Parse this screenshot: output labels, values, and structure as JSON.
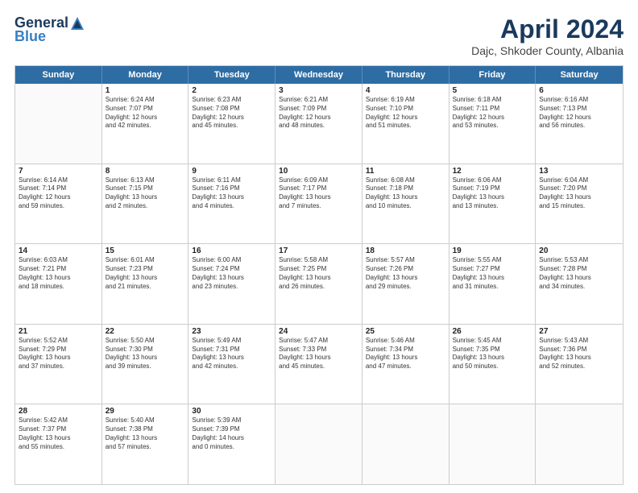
{
  "header": {
    "logo_general": "General",
    "logo_blue": "Blue",
    "month_title": "April 2024",
    "subtitle": "Dajc, Shkoder County, Albania"
  },
  "weekdays": [
    "Sunday",
    "Monday",
    "Tuesday",
    "Wednesday",
    "Thursday",
    "Friday",
    "Saturday"
  ],
  "rows": [
    [
      {
        "day": "",
        "text": ""
      },
      {
        "day": "1",
        "text": "Sunrise: 6:24 AM\nSunset: 7:07 PM\nDaylight: 12 hours\nand 42 minutes."
      },
      {
        "day": "2",
        "text": "Sunrise: 6:23 AM\nSunset: 7:08 PM\nDaylight: 12 hours\nand 45 minutes."
      },
      {
        "day": "3",
        "text": "Sunrise: 6:21 AM\nSunset: 7:09 PM\nDaylight: 12 hours\nand 48 minutes."
      },
      {
        "day": "4",
        "text": "Sunrise: 6:19 AM\nSunset: 7:10 PM\nDaylight: 12 hours\nand 51 minutes."
      },
      {
        "day": "5",
        "text": "Sunrise: 6:18 AM\nSunset: 7:11 PM\nDaylight: 12 hours\nand 53 minutes."
      },
      {
        "day": "6",
        "text": "Sunrise: 6:16 AM\nSunset: 7:13 PM\nDaylight: 12 hours\nand 56 minutes."
      }
    ],
    [
      {
        "day": "7",
        "text": "Sunrise: 6:14 AM\nSunset: 7:14 PM\nDaylight: 12 hours\nand 59 minutes."
      },
      {
        "day": "8",
        "text": "Sunrise: 6:13 AM\nSunset: 7:15 PM\nDaylight: 13 hours\nand 2 minutes."
      },
      {
        "day": "9",
        "text": "Sunrise: 6:11 AM\nSunset: 7:16 PM\nDaylight: 13 hours\nand 4 minutes."
      },
      {
        "day": "10",
        "text": "Sunrise: 6:09 AM\nSunset: 7:17 PM\nDaylight: 13 hours\nand 7 minutes."
      },
      {
        "day": "11",
        "text": "Sunrise: 6:08 AM\nSunset: 7:18 PM\nDaylight: 13 hours\nand 10 minutes."
      },
      {
        "day": "12",
        "text": "Sunrise: 6:06 AM\nSunset: 7:19 PM\nDaylight: 13 hours\nand 13 minutes."
      },
      {
        "day": "13",
        "text": "Sunrise: 6:04 AM\nSunset: 7:20 PM\nDaylight: 13 hours\nand 15 minutes."
      }
    ],
    [
      {
        "day": "14",
        "text": "Sunrise: 6:03 AM\nSunset: 7:21 PM\nDaylight: 13 hours\nand 18 minutes."
      },
      {
        "day": "15",
        "text": "Sunrise: 6:01 AM\nSunset: 7:23 PM\nDaylight: 13 hours\nand 21 minutes."
      },
      {
        "day": "16",
        "text": "Sunrise: 6:00 AM\nSunset: 7:24 PM\nDaylight: 13 hours\nand 23 minutes."
      },
      {
        "day": "17",
        "text": "Sunrise: 5:58 AM\nSunset: 7:25 PM\nDaylight: 13 hours\nand 26 minutes."
      },
      {
        "day": "18",
        "text": "Sunrise: 5:57 AM\nSunset: 7:26 PM\nDaylight: 13 hours\nand 29 minutes."
      },
      {
        "day": "19",
        "text": "Sunrise: 5:55 AM\nSunset: 7:27 PM\nDaylight: 13 hours\nand 31 minutes."
      },
      {
        "day": "20",
        "text": "Sunrise: 5:53 AM\nSunset: 7:28 PM\nDaylight: 13 hours\nand 34 minutes."
      }
    ],
    [
      {
        "day": "21",
        "text": "Sunrise: 5:52 AM\nSunset: 7:29 PM\nDaylight: 13 hours\nand 37 minutes."
      },
      {
        "day": "22",
        "text": "Sunrise: 5:50 AM\nSunset: 7:30 PM\nDaylight: 13 hours\nand 39 minutes."
      },
      {
        "day": "23",
        "text": "Sunrise: 5:49 AM\nSunset: 7:31 PM\nDaylight: 13 hours\nand 42 minutes."
      },
      {
        "day": "24",
        "text": "Sunrise: 5:47 AM\nSunset: 7:33 PM\nDaylight: 13 hours\nand 45 minutes."
      },
      {
        "day": "25",
        "text": "Sunrise: 5:46 AM\nSunset: 7:34 PM\nDaylight: 13 hours\nand 47 minutes."
      },
      {
        "day": "26",
        "text": "Sunrise: 5:45 AM\nSunset: 7:35 PM\nDaylight: 13 hours\nand 50 minutes."
      },
      {
        "day": "27",
        "text": "Sunrise: 5:43 AM\nSunset: 7:36 PM\nDaylight: 13 hours\nand 52 minutes."
      }
    ],
    [
      {
        "day": "28",
        "text": "Sunrise: 5:42 AM\nSunset: 7:37 PM\nDaylight: 13 hours\nand 55 minutes."
      },
      {
        "day": "29",
        "text": "Sunrise: 5:40 AM\nSunset: 7:38 PM\nDaylight: 13 hours\nand 57 minutes."
      },
      {
        "day": "30",
        "text": "Sunrise: 5:39 AM\nSunset: 7:39 PM\nDaylight: 14 hours\nand 0 minutes."
      },
      {
        "day": "",
        "text": ""
      },
      {
        "day": "",
        "text": ""
      },
      {
        "day": "",
        "text": ""
      },
      {
        "day": "",
        "text": ""
      }
    ]
  ]
}
